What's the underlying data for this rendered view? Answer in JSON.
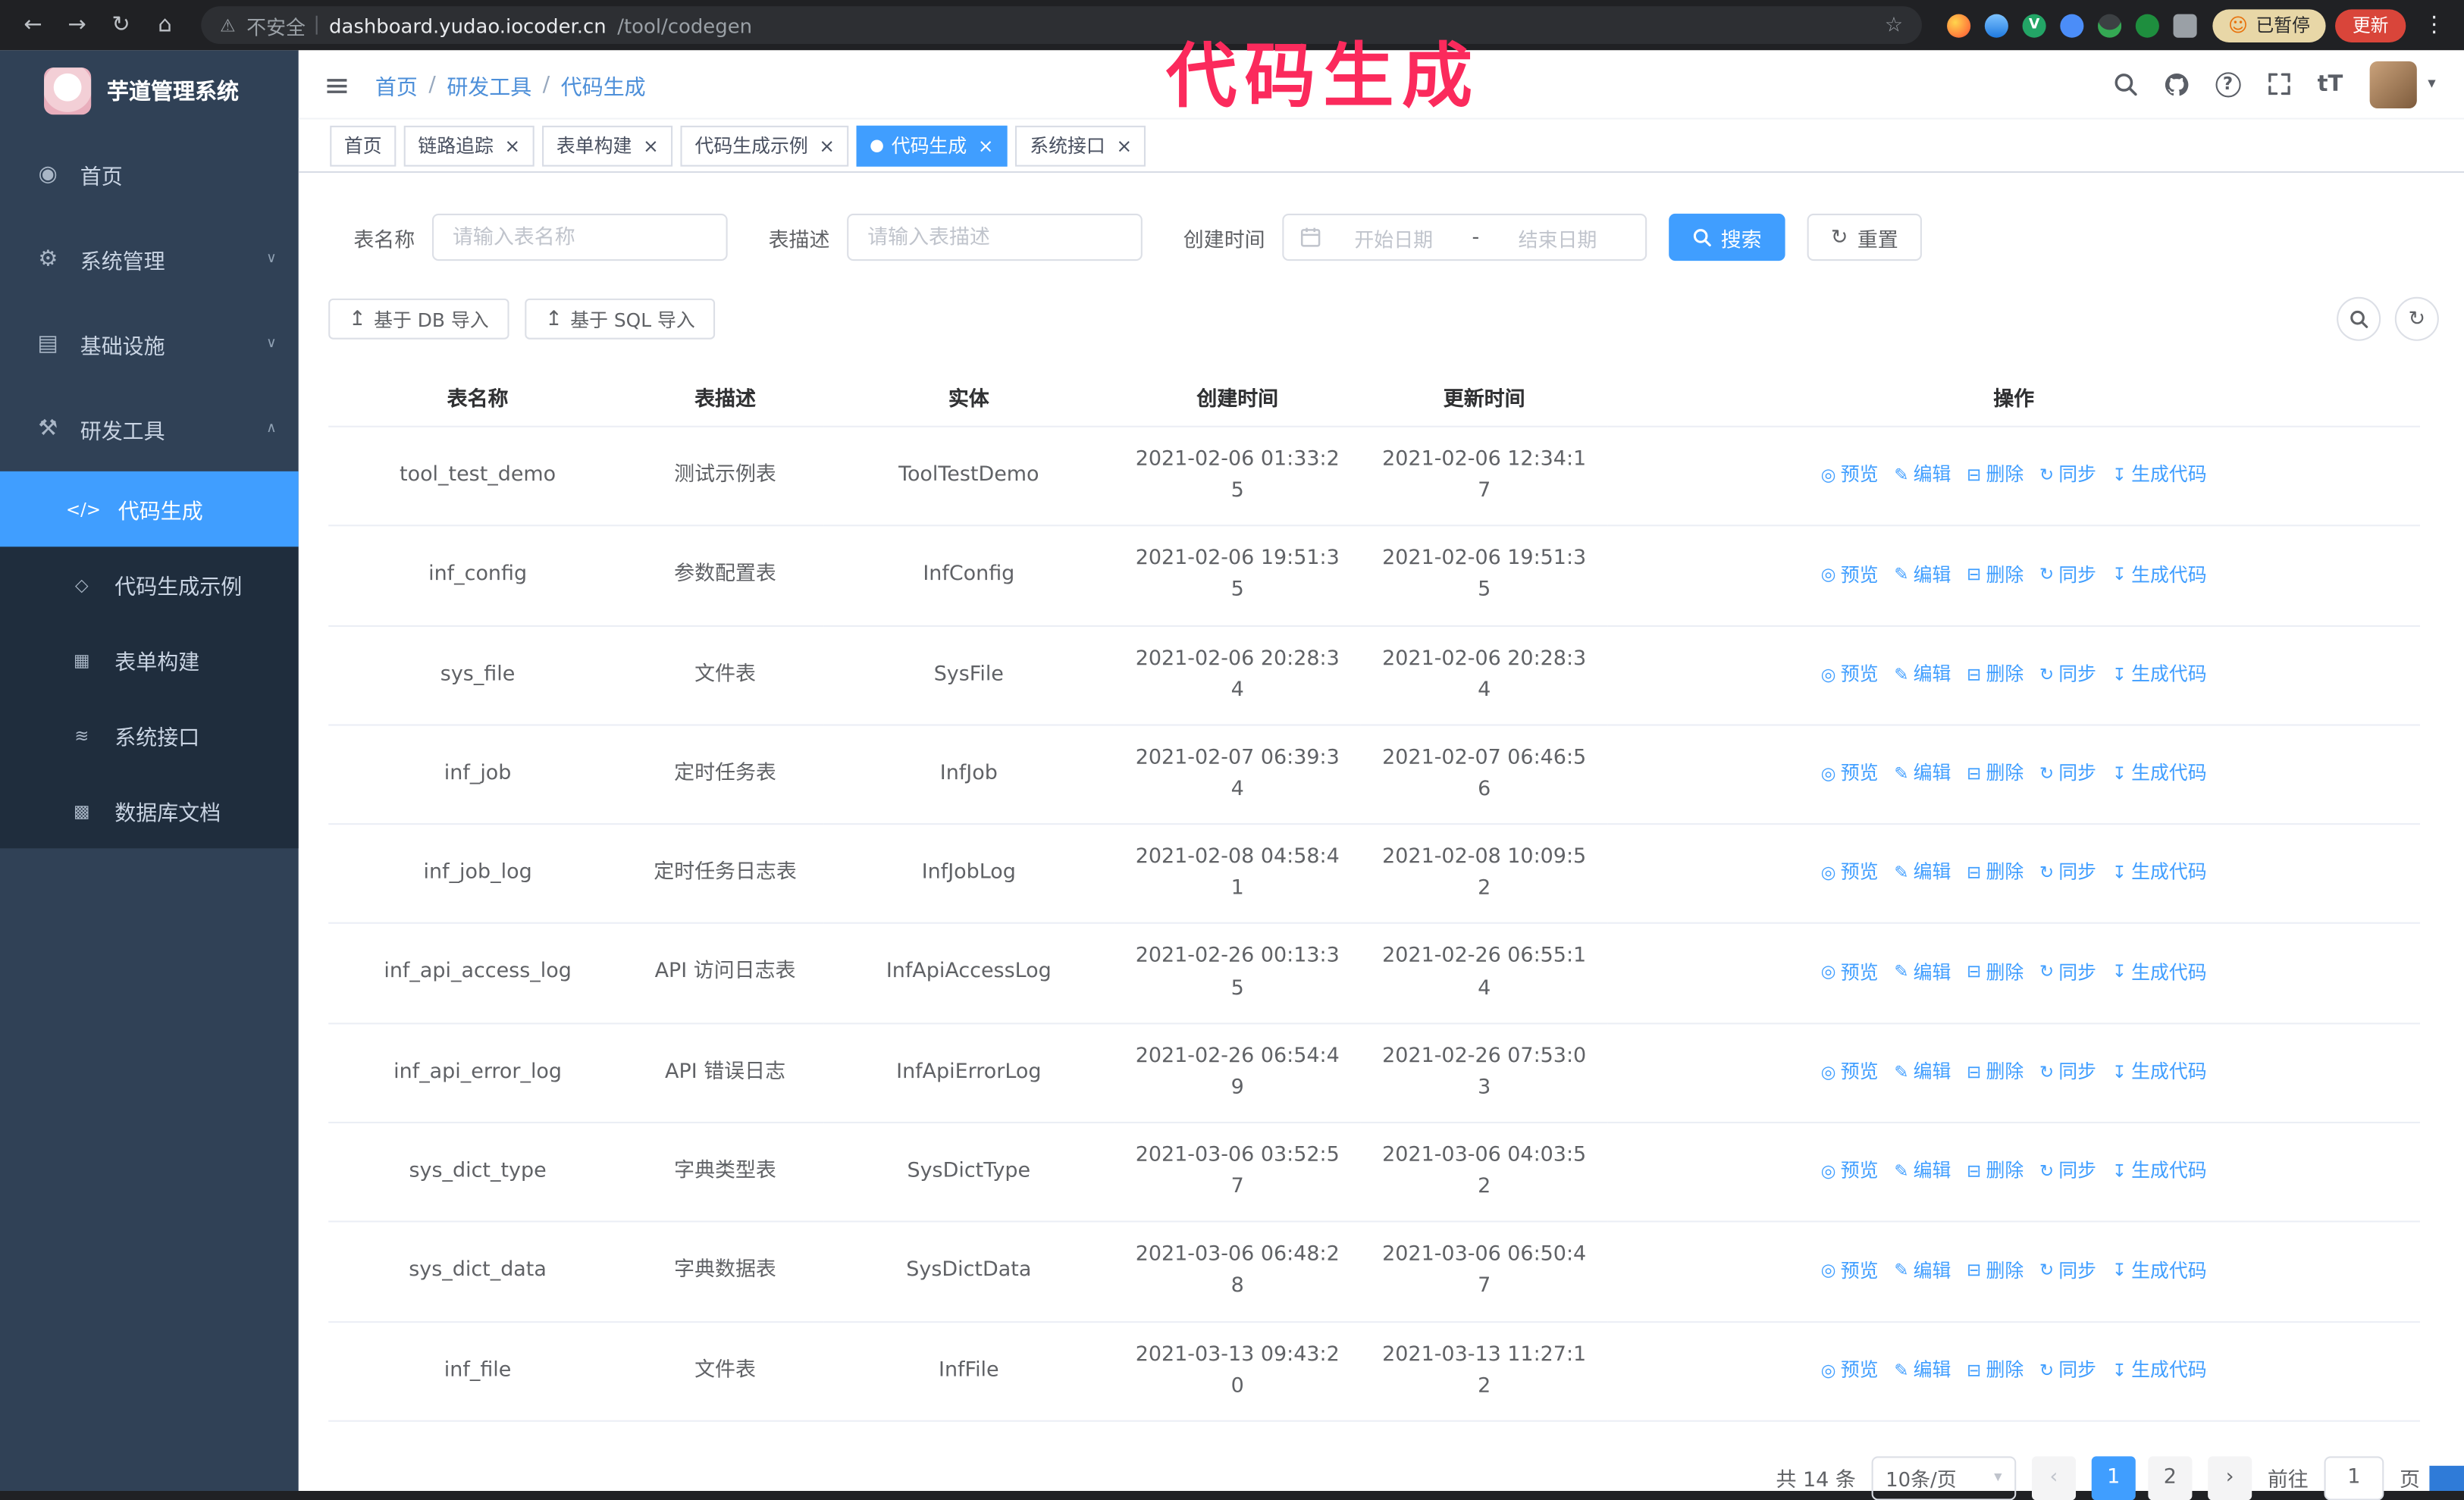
{
  "browser": {
    "security_label": "不安全",
    "url_host": "dashboard.yudao.iocoder.cn",
    "url_path": "/tool/codegen",
    "paused_chip": "已暂停",
    "update_button": "更新"
  },
  "annotation": {
    "text": "代码生成"
  },
  "sidebar": {
    "logo_title": "芋道管理系统",
    "items": [
      {
        "label": "首页",
        "icon": "dashboard"
      },
      {
        "label": "系统管理",
        "icon": "gear",
        "chevron": "down"
      },
      {
        "label": "基础设施",
        "icon": "infrastructure",
        "chevron": "down"
      },
      {
        "label": "研发工具",
        "icon": "tools",
        "chevron": "up",
        "expanded": true,
        "children": [
          {
            "label": "代码生成",
            "icon": "code",
            "active": true
          },
          {
            "label": "代码生成示例",
            "icon": "example"
          },
          {
            "label": "表单构建",
            "icon": "form-build"
          },
          {
            "label": "系统接口",
            "icon": "api"
          },
          {
            "label": "数据库文档",
            "icon": "database-doc"
          }
        ]
      }
    ]
  },
  "header": {
    "breadcrumb": [
      "首页",
      "研发工具",
      "代码生成"
    ]
  },
  "tabs": [
    {
      "label": "首页",
      "closable": false
    },
    {
      "label": "链路追踪",
      "closable": true
    },
    {
      "label": "表单构建",
      "closable": true
    },
    {
      "label": "代码生成示例",
      "closable": true
    },
    {
      "label": "代码生成",
      "closable": true,
      "active": true
    },
    {
      "label": "系统接口",
      "closable": true
    }
  ],
  "filters": {
    "table_name": {
      "label": "表名称",
      "placeholder": "请输入表名称"
    },
    "table_desc": {
      "label": "表描述",
      "placeholder": "请输入表描述"
    },
    "create_time": {
      "label": "创建时间",
      "start_placeholder": "开始日期",
      "separator": "-",
      "end_placeholder": "结束日期"
    },
    "search_label": "搜索",
    "reset_label": "重置"
  },
  "toolbar": {
    "import_db_label": "基于 DB 导入",
    "import_sql_label": "基于 SQL 导入"
  },
  "table": {
    "columns": [
      "表名称",
      "表描述",
      "实体",
      "创建时间",
      "更新时间",
      "操作"
    ],
    "actions": [
      "预览",
      "编辑",
      "删除",
      "同步",
      "生成代码"
    ],
    "rows": [
      {
        "name": "tool_test_demo",
        "desc": "测试示例表",
        "entity": "ToolTestDemo",
        "created": "2021-02-06 01:33:25",
        "updated": "2021-02-06 12:34:17"
      },
      {
        "name": "inf_config",
        "desc": "参数配置表",
        "entity": "InfConfig",
        "created": "2021-02-06 19:51:35",
        "updated": "2021-02-06 19:51:35"
      },
      {
        "name": "sys_file",
        "desc": "文件表",
        "entity": "SysFile",
        "created": "2021-02-06 20:28:34",
        "updated": "2021-02-06 20:28:34"
      },
      {
        "name": "inf_job",
        "desc": "定时任务表",
        "entity": "InfJob",
        "created": "2021-02-07 06:39:34",
        "updated": "2021-02-07 06:46:56"
      },
      {
        "name": "inf_job_log",
        "desc": "定时任务日志表",
        "entity": "InfJobLog",
        "created": "2021-02-08 04:58:41",
        "updated": "2021-02-08 10:09:52"
      },
      {
        "name": "inf_api_access_log",
        "desc": "API 访问日志表",
        "entity": "InfApiAccessLog",
        "created": "2021-02-26 00:13:35",
        "updated": "2021-02-26 06:55:14"
      },
      {
        "name": "inf_api_error_log",
        "desc": "API 错误日志",
        "entity": "InfApiErrorLog",
        "created": "2021-02-26 06:54:49",
        "updated": "2021-02-26 07:53:03"
      },
      {
        "name": "sys_dict_type",
        "desc": "字典类型表",
        "entity": "SysDictType",
        "created": "2021-03-06 03:52:57",
        "updated": "2021-03-06 04:03:52"
      },
      {
        "name": "sys_dict_data",
        "desc": "字典数据表",
        "entity": "SysDictData",
        "created": "2021-03-06 06:48:28",
        "updated": "2021-03-06 06:50:47"
      },
      {
        "name": "inf_file",
        "desc": "文件表",
        "entity": "InfFile",
        "created": "2021-03-13 09:43:20",
        "updated": "2021-03-13 11:27:12"
      }
    ]
  },
  "pagination": {
    "total_text": "共 14 条",
    "page_size_text": "10条/页",
    "pages": [
      "1",
      "2"
    ],
    "active_page": "1",
    "goto_label": "前往",
    "goto_value": "1",
    "goto_suffix": "页"
  },
  "colors": {
    "accent": "#409eff",
    "sidebar_bg": "#304156",
    "submenu_bg": "#1f2d3d",
    "annotation": "#fb2a5c",
    "update_red": "#d9453a"
  }
}
